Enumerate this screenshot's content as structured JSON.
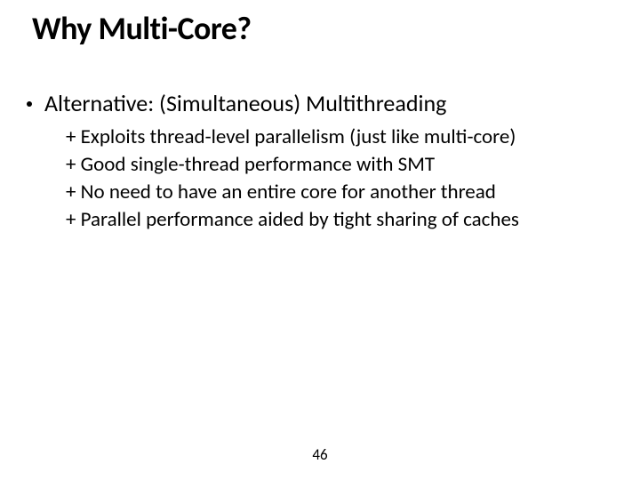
{
  "title": "Why Multi-Core?",
  "bullet": {
    "text": "Alternative: (Simultaneous) Multithreading"
  },
  "sub_items": [
    "+ Exploits thread-level parallelism (just like multi-core)",
    "+ Good single-thread performance with SMT",
    "+ No need to have an entire core for another thread",
    "+ Parallel performance aided by tight sharing of caches"
  ],
  "page_number": "46"
}
